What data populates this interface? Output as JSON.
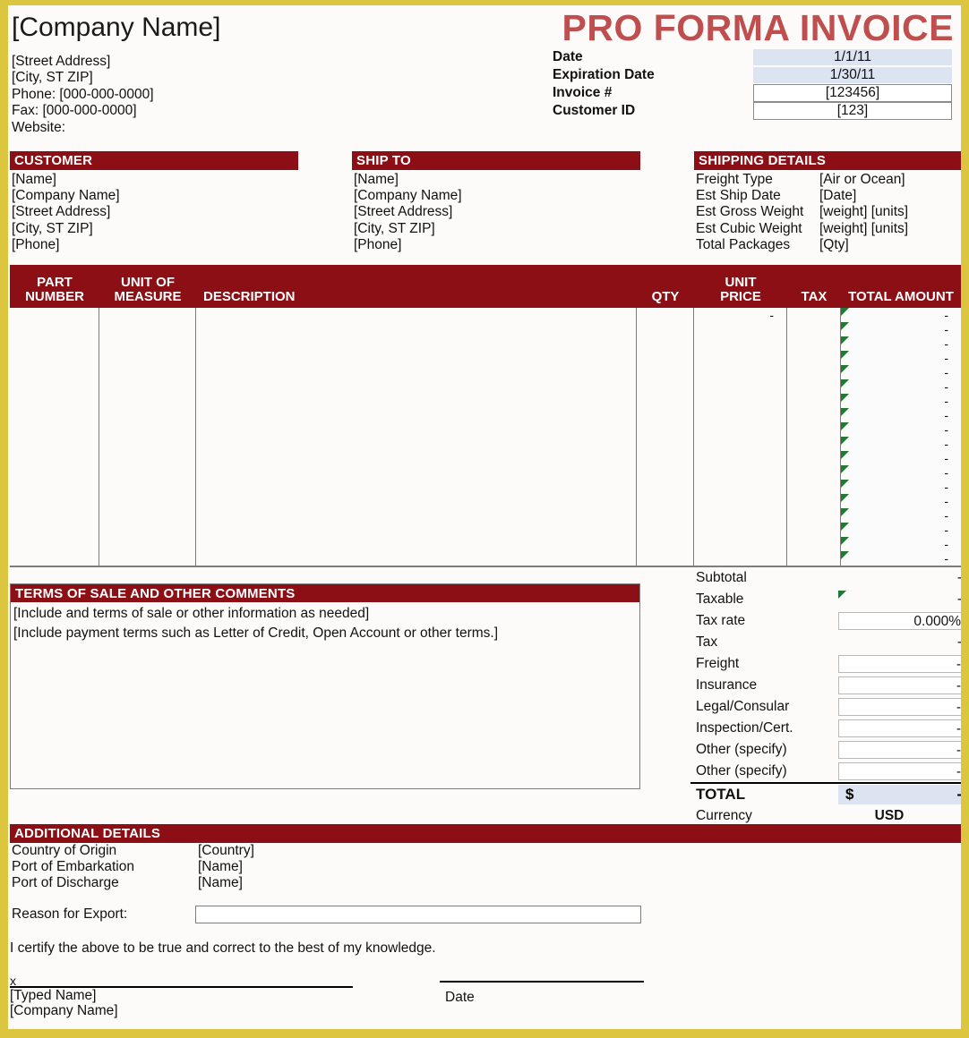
{
  "document": {
    "title": "PRO FORMA INVOICE",
    "accent_red": "#8b0f14",
    "title_red": "#bf4f4f",
    "border_gold": "#ddc63f",
    "shade_blue": "#dce3f1",
    "flag_green": "#1f7a36"
  },
  "company": {
    "name": "[Company Name]",
    "street": "[Street Address]",
    "city_state_zip": "[City, ST  ZIP]",
    "phone": "Phone: [000-000-0000]",
    "fax": "Fax: [000-000-0000]",
    "website": "Website:"
  },
  "meta": {
    "rows": [
      {
        "label": "Date",
        "value": "1/1/11",
        "style": "shade"
      },
      {
        "label": "Expiration Date",
        "value": "1/30/11",
        "style": "shade"
      },
      {
        "label": "Invoice #",
        "value": "[123456]",
        "style": "boxed"
      },
      {
        "label": "Customer ID",
        "value": "[123]",
        "style": "boxed"
      }
    ]
  },
  "customer": {
    "heading": "CUSTOMER",
    "lines": [
      "[Name]",
      "[Company Name]",
      "[Street Address]",
      "[City, ST  ZIP]",
      "[Phone]"
    ]
  },
  "ship_to": {
    "heading": "SHIP TO",
    "lines": [
      "[Name]",
      "[Company Name]",
      "[Street Address]",
      "[City, ST  ZIP]",
      "[Phone]"
    ]
  },
  "shipping_details": {
    "heading": "SHIPPING DETAILS",
    "rows": [
      {
        "key": "Freight Type",
        "value": "[Air or Ocean]"
      },
      {
        "key": "Est Ship Date",
        "value": "[Date]"
      },
      {
        "key": "Est Gross Weight",
        "value": "[weight] [units]"
      },
      {
        "key": "Est Cubic Weight",
        "value": "[weight] [units]"
      },
      {
        "key": "Total Packages",
        "value": "[Qty]"
      }
    ]
  },
  "items_table": {
    "columns": [
      {
        "label": "PART\nNUMBER",
        "align": "center"
      },
      {
        "label": "UNIT OF\nMEASURE",
        "align": "center"
      },
      {
        "label": "DESCRIPTION",
        "align": "left"
      },
      {
        "label": "QTY",
        "align": "center"
      },
      {
        "label": "UNIT\nPRICE",
        "align": "center"
      },
      {
        "label": "TAX",
        "align": "center"
      },
      {
        "label": "TOTAL AMOUNT",
        "align": "center"
      }
    ],
    "row_count": 18,
    "unit_price_first_row": "-",
    "total_amount_placeholder": "-"
  },
  "terms": {
    "heading": "TERMS OF SALE AND OTHER COMMENTS",
    "lines": [
      "[Include and terms of sale or other information as needed]",
      "[Include payment terms such as Letter of Credit, Open Account or other terms.]"
    ]
  },
  "totals": {
    "rows": [
      {
        "label": "Subtotal",
        "value": "-",
        "boxed": false,
        "flag": false
      },
      {
        "label": "Taxable",
        "value": "-",
        "boxed": false,
        "flag": true
      },
      {
        "label": "Tax rate",
        "value": "0.000%",
        "boxed": true,
        "flag": false
      },
      {
        "label": "Tax",
        "value": "-",
        "boxed": false,
        "flag": false
      },
      {
        "label": "Freight",
        "value": "-",
        "boxed": true,
        "flag": false
      },
      {
        "label": "Insurance",
        "value": "-",
        "boxed": true,
        "flag": false
      },
      {
        "label": "Legal/Consular",
        "value": "-",
        "boxed": true,
        "flag": false
      },
      {
        "label": "Inspection/Cert.",
        "value": "-",
        "boxed": true,
        "flag": false
      },
      {
        "label": "Other (specify)",
        "value": "-",
        "boxed": true,
        "flag": false
      },
      {
        "label": "Other (specify)",
        "value": "-",
        "boxed": true,
        "flag": false
      }
    ],
    "total_label": "TOTAL",
    "total_symbol": "$",
    "total_value": "-",
    "currency_label": "Currency",
    "currency_value": "USD"
  },
  "additional_details": {
    "heading": "ADDITIONAL DETAILS",
    "rows": [
      {
        "key": "Country of Origin",
        "value": "[Country]"
      },
      {
        "key": "Port of Embarkation",
        "value": "[Name]"
      },
      {
        "key": "Port of Discharge",
        "value": "[Name]"
      }
    ],
    "reason_label": "Reason for Export:",
    "reason_value": ""
  },
  "certification": {
    "statement": "I certify the above to be true and correct to the best of my knowledge.",
    "signature_mark": "x",
    "typed_name": "[Typed Name]",
    "company_name": "[Company Name]",
    "date_label": "Date",
    "watermark": ""
  }
}
